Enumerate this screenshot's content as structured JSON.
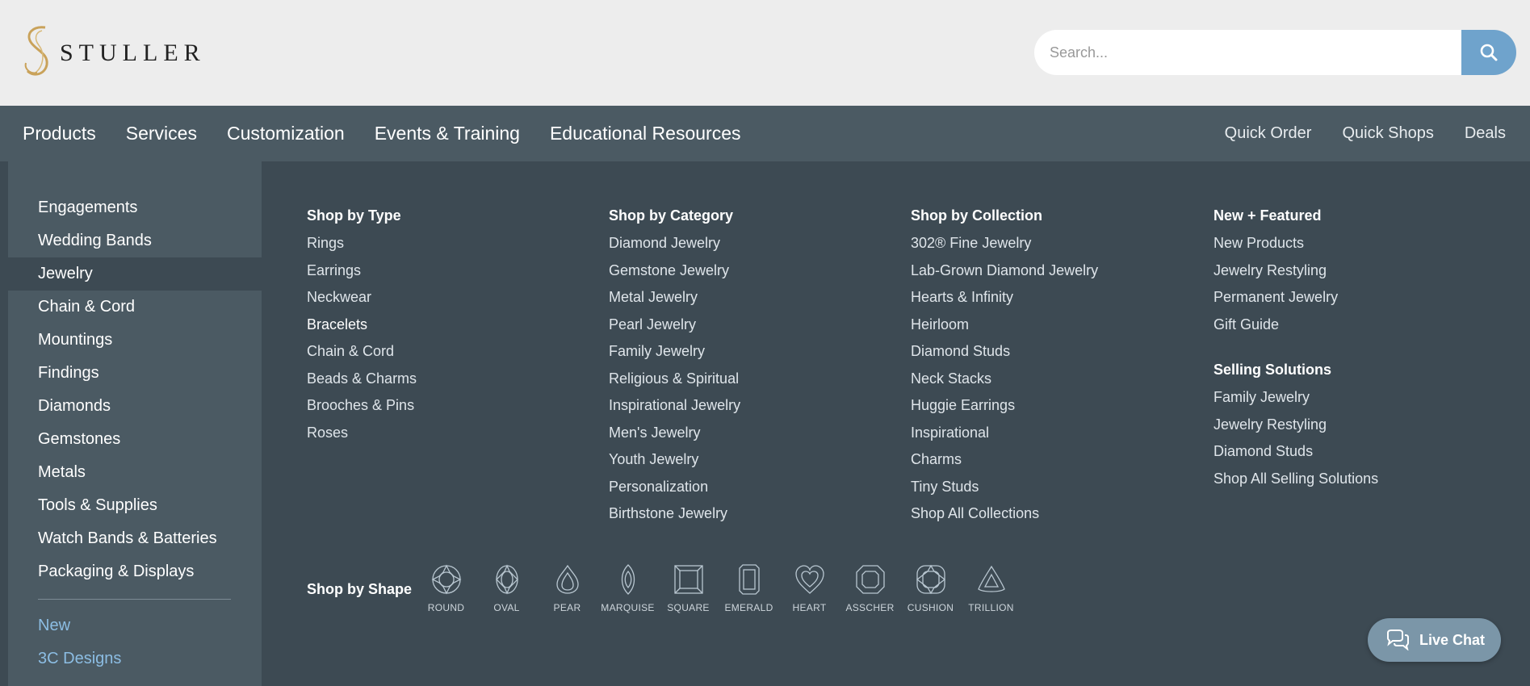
{
  "header": {
    "brand": "STULLER",
    "search_placeholder": "Search..."
  },
  "nav": {
    "primary": [
      "Products",
      "Services",
      "Customization",
      "Events & Training",
      "Educational Resources"
    ],
    "secondary": [
      "Quick Order",
      "Quick Shops",
      "Deals"
    ],
    "active": "Products"
  },
  "sidebar": {
    "items": [
      "Engagements",
      "Wedding Bands",
      "Jewelry",
      "Chain & Cord",
      "Mountings",
      "Findings",
      "Diamonds",
      "Gemstones",
      "Metals",
      "Tools & Supplies",
      "Watch Bands & Batteries",
      "Packaging & Displays"
    ],
    "active_item": "Jewelry",
    "extra_links": [
      "New",
      "3C Designs"
    ]
  },
  "menu": {
    "shop_by_type": {
      "heading": "Shop by Type",
      "links": [
        "Rings",
        "Earrings",
        "Neckwear",
        "Bracelets",
        "Chain & Cord",
        "Beads & Charms",
        "Brooches & Pins",
        "Roses"
      ]
    },
    "shop_by_category": {
      "heading": "Shop by Category",
      "links": [
        "Diamond Jewelry",
        "Gemstone Jewelry",
        "Metal Jewelry",
        "Pearl Jewelry",
        "Family Jewelry",
        "Religious & Spiritual",
        "Inspirational Jewelry",
        "Men's Jewelry",
        "Youth Jewelry",
        "Personalization",
        "Birthstone Jewelry"
      ]
    },
    "shop_by_collection": {
      "heading": "Shop by Collection",
      "links": [
        "302® Fine Jewelry",
        "Lab-Grown Diamond Jewelry",
        "Hearts & Infinity",
        "Heirloom",
        "Diamond Studs",
        "Neck Stacks",
        "Huggie Earrings",
        "Inspirational",
        "Charms",
        "Tiny Studs",
        "Shop All Collections"
      ]
    },
    "new_featured": {
      "heading": "New + Featured",
      "links": [
        "New Products",
        "Jewelry Restyling",
        "Permanent Jewelry",
        "Gift Guide"
      ]
    },
    "selling_solutions": {
      "heading": "Selling Solutions",
      "links": [
        "Family Jewelry",
        "Jewelry Restyling",
        "Diamond Studs",
        "Shop All Selling Solutions"
      ]
    }
  },
  "shapes": {
    "heading": "Shop by Shape",
    "items": [
      {
        "label": "ROUND",
        "icon": "round-diamond-icon"
      },
      {
        "label": "OVAL",
        "icon": "oval-diamond-icon"
      },
      {
        "label": "PEAR",
        "icon": "pear-diamond-icon"
      },
      {
        "label": "MARQUISE",
        "icon": "marquise-diamond-icon"
      },
      {
        "label": "SQUARE",
        "icon": "square-diamond-icon"
      },
      {
        "label": "EMERALD",
        "icon": "emerald-diamond-icon"
      },
      {
        "label": "HEART",
        "icon": "heart-diamond-icon"
      },
      {
        "label": "ASSCHER",
        "icon": "asscher-diamond-icon"
      },
      {
        "label": "CUSHION",
        "icon": "cushion-diamond-icon"
      },
      {
        "label": "TRILLION",
        "icon": "trillion-diamond-icon"
      }
    ]
  },
  "chat": {
    "label": "Live Chat"
  },
  "colors": {
    "header_bg": "#ededed",
    "nav_bg": "#4b5a63",
    "menu_bg": "#3d4a53",
    "accent_blue": "#6fa3cc",
    "link_blue": "#8cbde3",
    "logo_gold": "#c9a25a",
    "chat_bg": "#7b96a8"
  }
}
